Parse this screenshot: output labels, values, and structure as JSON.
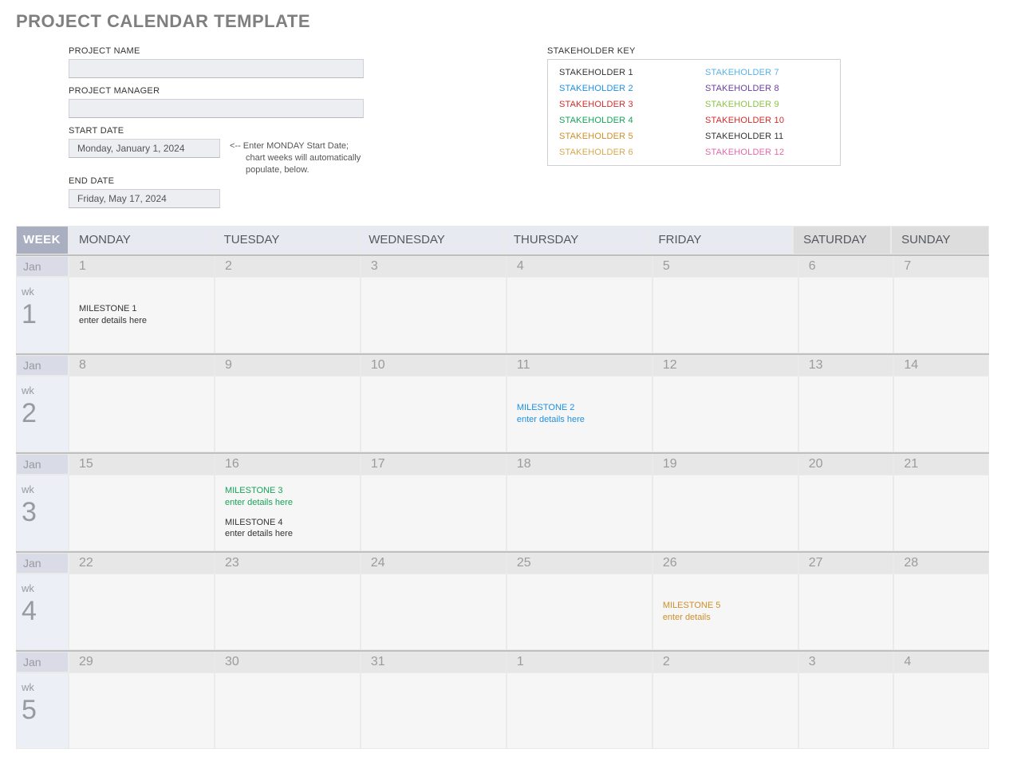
{
  "title": "PROJECT CALENDAR TEMPLATE",
  "meta": {
    "project_name_label": "PROJECT NAME",
    "project_name_value": "",
    "project_manager_label": "PROJECT MANAGER",
    "project_manager_value": "",
    "start_date_label": "START DATE",
    "start_date_value": "Monday, January 1, 2024",
    "end_date_label": "END DATE",
    "end_date_value": "Friday, May 17, 2024",
    "hint_line1": "<-- Enter MONDAY Start Date;",
    "hint_line2": "chart weeks will automatically",
    "hint_line3": "populate, below."
  },
  "stakeholders": {
    "label": "STAKEHOLDER KEY",
    "items": [
      {
        "label": "STAKEHOLDER 1",
        "color": "#333333"
      },
      {
        "label": "STAKEHOLDER 2",
        "color": "#1e90e2"
      },
      {
        "label": "STAKEHOLDER 3",
        "color": "#d12c2c"
      },
      {
        "label": "STAKEHOLDER 4",
        "color": "#17a358"
      },
      {
        "label": "STAKEHOLDER 5",
        "color": "#cf8f2a"
      },
      {
        "label": "STAKEHOLDER 6",
        "color": "#d6a84f"
      },
      {
        "label": "STAKEHOLDER 7",
        "color": "#58b3e6"
      },
      {
        "label": "STAKEHOLDER 8",
        "color": "#6a3ea1"
      },
      {
        "label": "STAKEHOLDER 9",
        "color": "#8bc34a"
      },
      {
        "label": "STAKEHOLDER 10",
        "color": "#d12c2c"
      },
      {
        "label": "STAKEHOLDER 11",
        "color": "#333333"
      },
      {
        "label": "STAKEHOLDER 12",
        "color": "#e36aa8"
      }
    ]
  },
  "calendar": {
    "week_header": "WEEK",
    "week_label": "wk",
    "days": [
      "MONDAY",
      "TUESDAY",
      "WEDNESDAY",
      "THURSDAY",
      "FRIDAY",
      "SATURDAY",
      "SUNDAY"
    ],
    "weekend_idx": [
      5,
      6
    ],
    "weeks": [
      {
        "month": "Jan",
        "num": "1",
        "cells": [
          {
            "n": "1",
            "items": [
              {
                "title": "MILESTONE 1",
                "detail": "enter details here",
                "color": "#333333"
              }
            ]
          },
          {
            "n": "2"
          },
          {
            "n": "3"
          },
          {
            "n": "4"
          },
          {
            "n": "5"
          },
          {
            "n": "6"
          },
          {
            "n": "7"
          }
        ]
      },
      {
        "month": "Jan",
        "num": "2",
        "cells": [
          {
            "n": "8"
          },
          {
            "n": "9"
          },
          {
            "n": "10"
          },
          {
            "n": "11",
            "items": [
              {
                "title": "MILESTONE 2",
                "detail": "enter details here",
                "color": "#1e90e2"
              }
            ]
          },
          {
            "n": "12"
          },
          {
            "n": "13"
          },
          {
            "n": "14"
          }
        ]
      },
      {
        "month": "Jan",
        "num": "3",
        "cells": [
          {
            "n": "15"
          },
          {
            "n": "16",
            "items": [
              {
                "title": "MILESTONE 3",
                "detail": "enter details here",
                "color": "#17a358"
              },
              {
                "title": "MILESTONE 4",
                "detail": "enter details here",
                "color": "#333333"
              }
            ]
          },
          {
            "n": "17"
          },
          {
            "n": "18"
          },
          {
            "n": "19"
          },
          {
            "n": "20"
          },
          {
            "n": "21"
          }
        ]
      },
      {
        "month": "Jan",
        "num": "4",
        "cells": [
          {
            "n": "22"
          },
          {
            "n": "23"
          },
          {
            "n": "24"
          },
          {
            "n": "25"
          },
          {
            "n": "26",
            "items": [
              {
                "title": "MILESTONE 5",
                "detail": "enter details",
                "color": "#cf8f2a"
              }
            ]
          },
          {
            "n": "27"
          },
          {
            "n": "28"
          }
        ]
      },
      {
        "month": "Jan",
        "num": "5",
        "cells": [
          {
            "n": "29"
          },
          {
            "n": "30"
          },
          {
            "n": "31"
          },
          {
            "n": "1"
          },
          {
            "n": "2"
          },
          {
            "n": "3"
          },
          {
            "n": "4"
          }
        ]
      }
    ]
  }
}
